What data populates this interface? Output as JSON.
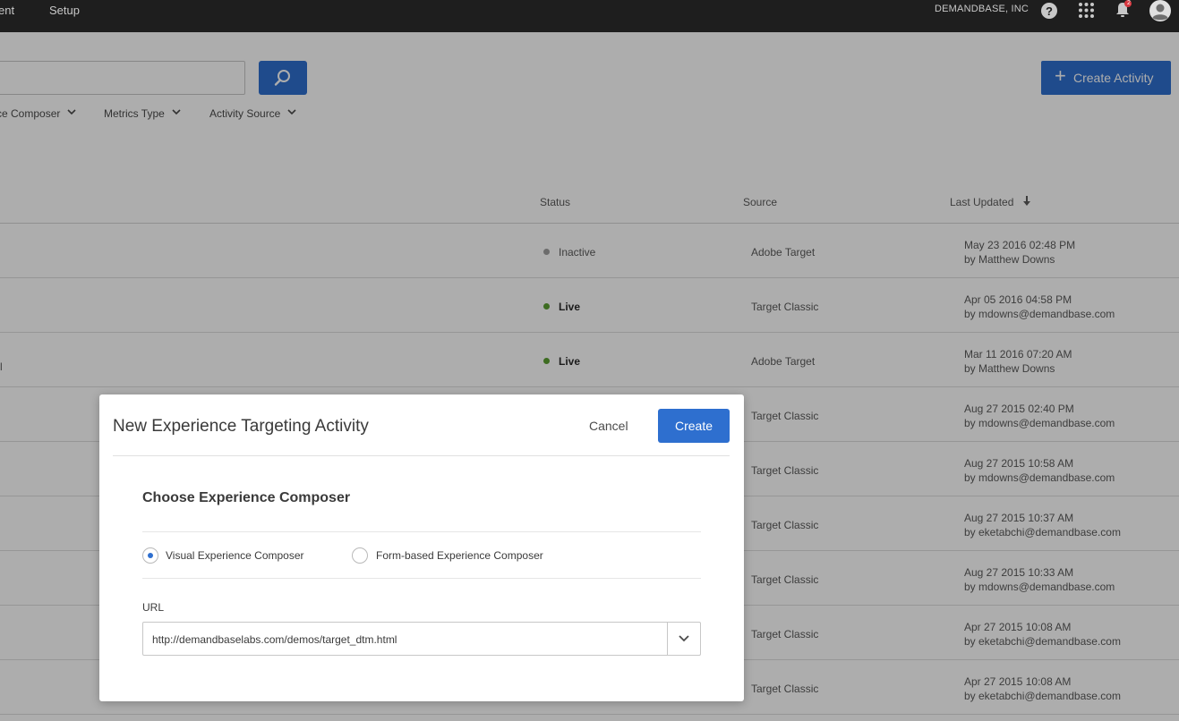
{
  "topbar": {
    "nav_cut": "ent",
    "setup": "Setup",
    "org": "DEMANDBASE, INC",
    "notification_count": "2"
  },
  "toolbar": {
    "create_activity": "Create Activity"
  },
  "filters": [
    {
      "label": "ce Composer"
    },
    {
      "label": "Metrics Type"
    },
    {
      "label": "Activity Source"
    }
  ],
  "table": {
    "headers": {
      "status": "Status",
      "source": "Source",
      "last_updated": "Last Updated"
    },
    "rows": [
      {
        "name": "",
        "status": "Inactive",
        "status_color": "#a0a0a0",
        "source": "Adobe Target",
        "date": "May 23 2016 02:48 PM",
        "by": "by Matthew Downs"
      },
      {
        "name": "",
        "status": "Live",
        "status_color": "#5aa032",
        "source": "Target Classic",
        "date": "Apr 05 2016 04:58 PM",
        "by": "by mdowns@demandbase.com"
      },
      {
        "name": "l",
        "status": "Live",
        "status_color": "#5aa032",
        "source": "Adobe Target",
        "date": "Mar 11 2016 07:20 AM",
        "by": "by Matthew Downs"
      },
      {
        "name": "",
        "status": "",
        "status_color": "",
        "source": "Target Classic",
        "date": "Aug 27 2015 02:40 PM",
        "by": "by mdowns@demandbase.com"
      },
      {
        "name": "",
        "status": "",
        "status_color": "",
        "source": "Target Classic",
        "date": "Aug 27 2015 10:58 AM",
        "by": "by mdowns@demandbase.com"
      },
      {
        "name": "",
        "status": "",
        "status_color": "",
        "source": "Target Classic",
        "date": "Aug 27 2015 10:37 AM",
        "by": "by eketabchi@demandbase.com"
      },
      {
        "name": "",
        "status": "",
        "status_color": "",
        "source": "Target Classic",
        "date": "Aug 27 2015 10:33 AM",
        "by": "by mdowns@demandbase.com"
      },
      {
        "name": "",
        "status": "",
        "status_color": "",
        "source": "Target Classic",
        "date": "Apr 27 2015 10:08 AM",
        "by": "by eketabchi@demandbase.com"
      },
      {
        "name": "",
        "status": "",
        "status_color": "",
        "source": "Target Classic",
        "date": "Apr 27 2015 10:08 AM",
        "by": "by eketabchi@demandbase.com"
      }
    ]
  },
  "modal": {
    "title": "New Experience Targeting Activity",
    "cancel": "Cancel",
    "create": "Create",
    "subtitle": "Choose Experience Composer",
    "options": [
      {
        "label": "Visual Experience Composer",
        "selected": true
      },
      {
        "label": "Form-based Experience Composer",
        "selected": false
      }
    ],
    "url_label": "URL",
    "url_value": "http://demandbaselabs.com/demos/target_dtm.html"
  },
  "colors": {
    "accent": "#2e6fcf",
    "live": "#5aa032",
    "inactive": "#a0a0a0"
  }
}
